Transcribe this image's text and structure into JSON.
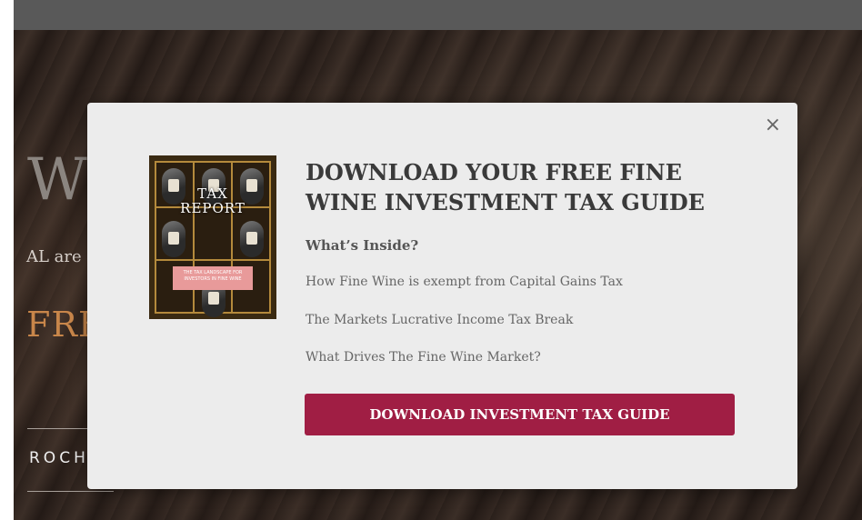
{
  "background": {
    "heading": "W",
    "subtext": "AL are",
    "cta": "FRE",
    "button_label": "ROCHU"
  },
  "modal": {
    "close_label": "×",
    "cover": {
      "title_line1": "TAX",
      "title_line2": "REPORT",
      "band_line1": "THE TAX LANDSCAPE FOR",
      "band_line2": "INVESTORS IN FINE WINE"
    },
    "title": "DOWNLOAD YOUR FREE FINE WINE INVESTMENT TAX GUIDE",
    "subhead": "What’s Inside?",
    "items": [
      "How Fine Wine is exempt from Capital Gains Tax",
      "The Markets Lucrative Income Tax Break",
      "What Drives The Fine Wine Market?"
    ],
    "button_label": "DOWNLOAD INVESTMENT TAX GUIDE"
  },
  "colors": {
    "accent": "#a01e44",
    "modal_bg": "#ececec",
    "topbar": "#595959"
  }
}
